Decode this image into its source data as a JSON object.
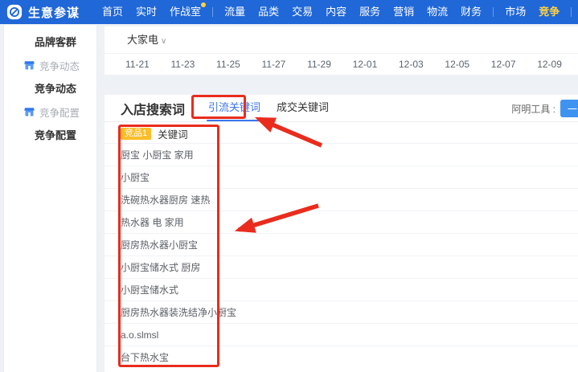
{
  "nav": {
    "brand": "生意参谋",
    "items": [
      "首页",
      "实时",
      "作战室",
      "流量",
      "品类",
      "交易",
      "内容",
      "服务",
      "营销",
      "物流",
      "财务",
      "市场",
      "竞争"
    ],
    "active_item": "竞争",
    "notification_dot_on": "作战室"
  },
  "sidebar": {
    "items": [
      {
        "label": "品牌客群",
        "type": "header"
      },
      {
        "label": "竞争动态",
        "type": "link"
      },
      {
        "label": "竞争动态",
        "type": "header"
      },
      {
        "label": "竞争配置",
        "type": "link"
      },
      {
        "label": "竞争配置",
        "type": "header"
      }
    ]
  },
  "timeline": {
    "category": "大家电",
    "dates": [
      "11-21",
      "11-23",
      "11-25",
      "11-27",
      "11-29",
      "12-01",
      "12-03",
      "12-05",
      "12-07",
      "12-09"
    ]
  },
  "search_section": {
    "title": "入店搜索词",
    "tabs": [
      {
        "label": "引流关键词",
        "active": true
      },
      {
        "label": "成交关键词",
        "active": false
      }
    ],
    "tools_label": "阿明工具 :",
    "tool_button_text": "一",
    "table": {
      "competitor_badge": "竞品1",
      "column_header": "关键词",
      "keywords": [
        "厨宝 小厨宝 家用",
        "小厨宝",
        "洗碗热水器厨房 速热",
        "热水器 电 家用",
        "厨房热水器小厨宝",
        "小厨宝储水式 厨房",
        "小厨宝储水式",
        "厨房热水器装洗结净小厨宝",
        "a.o.slmsl",
        "台下热水宝"
      ]
    }
  },
  "colors": {
    "nav_background": "#2067d8",
    "nav_active_text": "#ffd23f",
    "active_tab": "#3b74f0",
    "annotation_red": "#e92c1d",
    "badge_yellow": "#fcbd2a",
    "tool_button_blue": "#3f93f0"
  }
}
